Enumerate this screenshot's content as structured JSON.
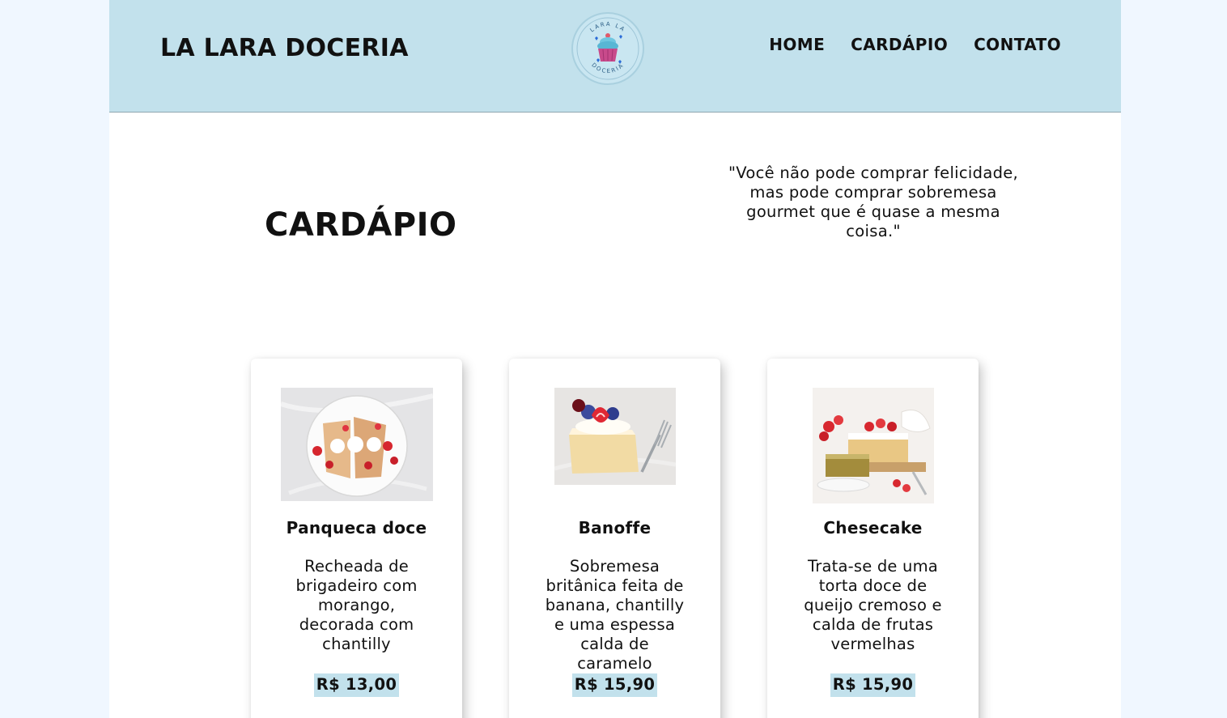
{
  "header": {
    "brand": "LA LARA DOCERIA",
    "logo_text_top": "LARA LA",
    "logo_text_bottom": "DOCERIA",
    "nav": [
      "HOME",
      "CARDÁPIO",
      "CONTATO"
    ]
  },
  "main": {
    "title": "CARDÁPIO",
    "quote": "\"Você não pode comprar felicidade, mas pode comprar sobremesa gourmet que é quase a mesma coisa.\""
  },
  "products": [
    {
      "name": "Panqueca doce",
      "description": "Recheada de brigadeiro com morango, decorada com chantilly",
      "price": "R$ 13,00"
    },
    {
      "name": "Banoffe",
      "description": "Sobremesa britânica feita de banana, chantilly e uma espessa calda de caramelo",
      "price": "R$ 15,90"
    },
    {
      "name": "Chesecake",
      "description": "Trata-se de uma torta doce de queijo cremoso e calda de frutas vermelhas",
      "price": "R$ 15,90"
    }
  ],
  "colors": {
    "header_bg": "#c2e1ec",
    "price_highlight": "#c2e1ec",
    "outer_bg": "#f0f7ff"
  }
}
